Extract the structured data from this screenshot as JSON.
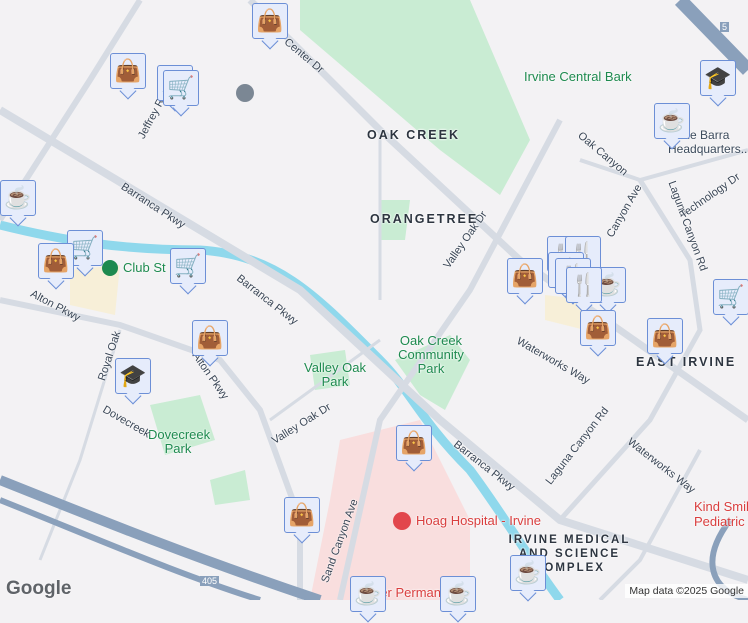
{
  "parks": {
    "central": "Irvine Central Bark",
    "oak_creek_park": "Oak Creek Community Park",
    "valley_oak": "Valley Oak Park",
    "dovecreek": "Dovecreek Park"
  },
  "areas": {
    "oak_creek": "OAK CREEK",
    "orangetree": "ORANGETREE",
    "east_irvine": "EAST IRVINE",
    "medical": "IRVINE MEDICAL AND SCIENCE COMPLEX"
  },
  "roads": {
    "center_dr": "Center Dr",
    "jeffrey": "Jeffrey Rd",
    "barranca1": "Barranca Pkwy",
    "barranca2": "Barranca Pkwy",
    "barranca3": "Barranca Pkwy",
    "alton1": "Alton Pkwy",
    "alton2": "Alton Pkwy",
    "royal_oak": "Royal Oak",
    "dovecreek": "Dovecreek",
    "valley_oak1": "Valley Oak Dr",
    "valley_oak2": "Valley Oak Dr",
    "sand_canyon": "Sand Canyon Ave",
    "laguna1": "Laguna Canyon Rd",
    "laguna2": "Laguna Canyon Rd",
    "oak_canyon": "Oak Canyon",
    "canyon_ave": "Canyon Ave",
    "technology": "Technology Dr",
    "waterworks1": "Waterworks Way",
    "waterworks2": "Waterworks Way",
    "i405": "405",
    "i5": "5"
  },
  "pois": {
    "club": "Club St",
    "hoag": "Hoag Hospital - Irvine",
    "kind": "Kind Smiles Pediatric",
    "kaiser": "Kaiser Permanente",
    "barra": "Lucie Barra Headquarters..."
  },
  "branding": {
    "google": "Google",
    "attribution": "Map data ©2025 Google"
  },
  "colors": {
    "marker_fill": "#e6ecfb",
    "marker_border": "#6c8fd6",
    "marker_icon": "#0b4a6e",
    "park": "#c9ecd3",
    "water": "#8fd8ec",
    "highway": "#8aa0bb",
    "hospital": "#f9dede"
  }
}
